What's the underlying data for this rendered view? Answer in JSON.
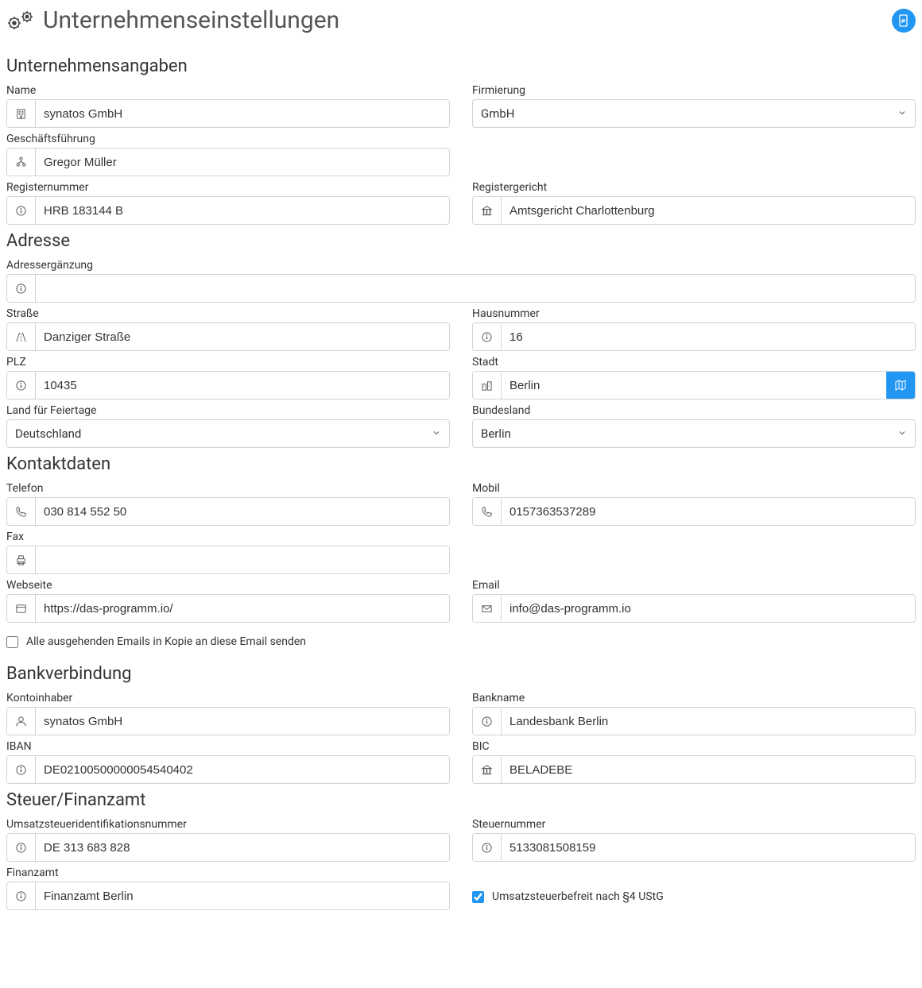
{
  "header": {
    "title": "Unternehmenseinstellungen"
  },
  "sections": {
    "company": {
      "title": "Unternehmensangaben",
      "name_label": "Name",
      "name_value": "synatos GmbH",
      "firm_label": "Firmierung",
      "firm_value": "GmbH",
      "mgmt_label": "Geschäftsführung",
      "mgmt_value": "Gregor Müller",
      "regnum_label": "Registernummer",
      "regnum_value": "HRB 183144 B",
      "regcourt_label": "Registergericht",
      "regcourt_value": "Amtsgericht Charlottenburg"
    },
    "address": {
      "title": "Adresse",
      "supplement_label": "Adressergänzung",
      "supplement_value": "",
      "street_label": "Straße",
      "street_value": "Danziger Straße",
      "houseno_label": "Hausnummer",
      "houseno_value": "16",
      "zip_label": "PLZ",
      "zip_value": "10435",
      "city_label": "Stadt",
      "city_value": "Berlin",
      "country_label": "Land für Feiertage",
      "country_value": "Deutschland",
      "state_label": "Bundesland",
      "state_value": "Berlin"
    },
    "contact": {
      "title": "Kontaktdaten",
      "phone_label": "Telefon",
      "phone_value": "030 814 552 50",
      "mobile_label": "Mobil",
      "mobile_value": "0157363537289",
      "fax_label": "Fax",
      "fax_value": "",
      "website_label": "Webseite",
      "website_value": "https://das-programm.io/",
      "email_label": "Email",
      "email_value": "info@das-programm.io",
      "cc_label": "Alle ausgehenden Emails in Kopie an diese Email senden"
    },
    "bank": {
      "title": "Bankverbindung",
      "holder_label": "Kontoinhaber",
      "holder_value": "synatos GmbH",
      "bankname_label": "Bankname",
      "bankname_value": "Landesbank Berlin",
      "iban_label": "IBAN",
      "iban_value": "DE02100500000054540402",
      "bic_label": "BIC",
      "bic_value": "BELADEBE"
    },
    "tax": {
      "title": "Steuer/Finanzamt",
      "vatid_label": "Umsatzsteueridentifikationsnummer",
      "vatid_value": "DE 313 683 828",
      "taxno_label": "Steuernummer",
      "taxno_value": "5133081508159",
      "office_label": "Finanzamt",
      "office_value": "Finanzamt Berlin",
      "exempt_label": "Umsatzsteuerbefreit nach §4 UStG"
    }
  }
}
